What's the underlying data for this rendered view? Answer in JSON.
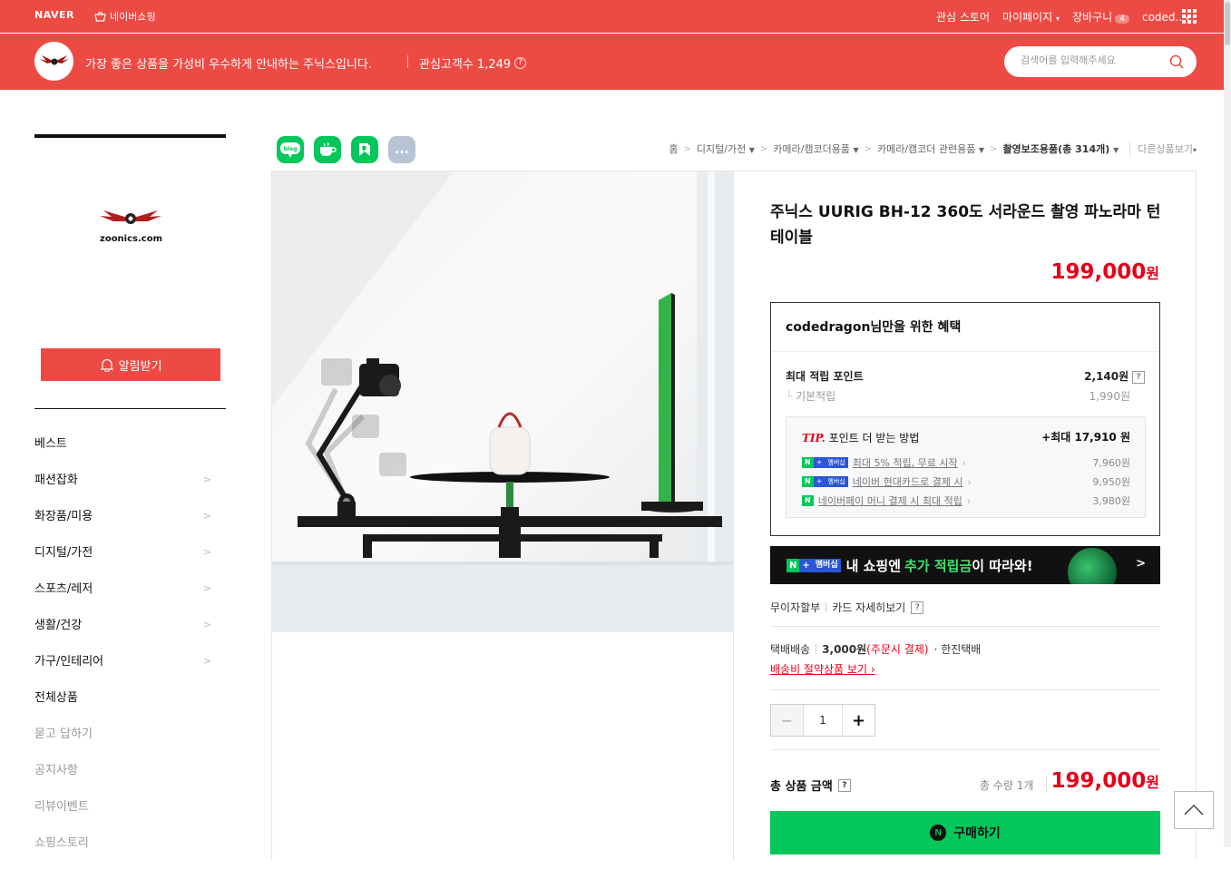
{
  "top_bar": {
    "naver_label": "NAVER",
    "shopping_label": "네이버쇼핑",
    "interest_store": "관심 스토어",
    "mypage": "마이페이지",
    "cart": "장바구니",
    "cart_count": "4",
    "user": "coded..",
    "apps_icon": "grid-icon"
  },
  "store": {
    "logo_text": "zoonics.com",
    "description": "가장 좋은 상품을 가성비 우수하게 안내하는 주닉스입니다.",
    "fans_label": "관심고객수 1,249",
    "help_label": "?",
    "search_placeholder": "검색어를 입력해주세요"
  },
  "sidebar": {
    "brand": "zoonics.com",
    "alarm_button": "알림받기",
    "categories": [
      {
        "label": "베스트",
        "has_arrow": false,
        "muted": false
      },
      {
        "label": "패션잡화",
        "has_arrow": true,
        "muted": false
      },
      {
        "label": "화장품/미용",
        "has_arrow": true,
        "muted": false
      },
      {
        "label": "디지털/가전",
        "has_arrow": true,
        "muted": false
      },
      {
        "label": "스포츠/레저",
        "has_arrow": true,
        "muted": false
      },
      {
        "label": "생활/건강",
        "has_arrow": true,
        "muted": false
      },
      {
        "label": "가구/인테리어",
        "has_arrow": true,
        "muted": false
      },
      {
        "label": "전체상품",
        "has_arrow": false,
        "muted": false
      },
      {
        "label": "묻고 답하기",
        "has_arrow": false,
        "muted": true
      },
      {
        "label": "공지사항",
        "has_arrow": false,
        "muted": true
      },
      {
        "label": "리뷰이벤트",
        "has_arrow": false,
        "muted": true
      },
      {
        "label": "쇼핑스토리",
        "has_arrow": false,
        "muted": true
      }
    ]
  },
  "share": {
    "blog": "blog",
    "cafe": "cafe",
    "band": "band",
    "more": "..."
  },
  "breadcrumb": {
    "home": "홈",
    "level1": "디지털/가전",
    "level2": "카메라/캠코더용품",
    "level3": "카메라/캠코더 관련용품",
    "current": "촬영보조용품(총 314개)",
    "others": "다른상품보기"
  },
  "product": {
    "title": "주닉스 UURIG BH-12 360도 서라운드 촬영 파노라마 턴테이블",
    "price": "199,000",
    "currency": "원"
  },
  "benefit": {
    "title": "codedragon님만을 위한 혜택",
    "max_point_label": "최대 적립 포인트",
    "max_point_value": "2,140원",
    "help": "?",
    "basic_label": "기본적립",
    "basic_value": "1,990원",
    "tip_label": "TIP.",
    "tip_text": "포인트 더 받는 방법",
    "tip_max": "+최대 17,910 원",
    "tip_rows": [
      {
        "badge": "N+멤버십",
        "text": "최대 5% 적립, 무료 시작",
        "value": "7,960원"
      },
      {
        "badge": "N+멤버십",
        "text": "네이버 현대카드로 결제 시",
        "value": "9,950원"
      },
      {
        "badge": "N",
        "text": "네이버페이 머니 결제 시 최대 적립",
        "value": "3,980원"
      }
    ],
    "membership_badge_n": "N",
    "membership_badge_plus": "+",
    "membership_badge_text": "멤버십"
  },
  "banner": {
    "badge_n": "N",
    "badge_plus": "+",
    "badge_text": "멤버십",
    "text_pre": "내 쇼핑엔",
    "text_green": "추가 적립금",
    "text_post": "이 따라와!"
  },
  "payment": {
    "installment": "무이자할부",
    "card": "카드 자세히보기",
    "help": "?"
  },
  "shipping": {
    "type": "택배배송",
    "fee": "3,000원",
    "fee_note": "(주문시 결제)",
    "courier": "· 한진택배",
    "saving_link": "배송비 절약상품 보기"
  },
  "quantity": {
    "value": "1"
  },
  "total": {
    "label": "총 상품 금액",
    "help": "?",
    "count": "총 수량 1개",
    "price": "199,000",
    "currency": "원"
  },
  "buy": {
    "label": "구매하기",
    "icon_letter": "N"
  },
  "colors": {
    "brand": "#ee4a44",
    "price_red": "#e50019",
    "naver_green": "#03c75a"
  }
}
